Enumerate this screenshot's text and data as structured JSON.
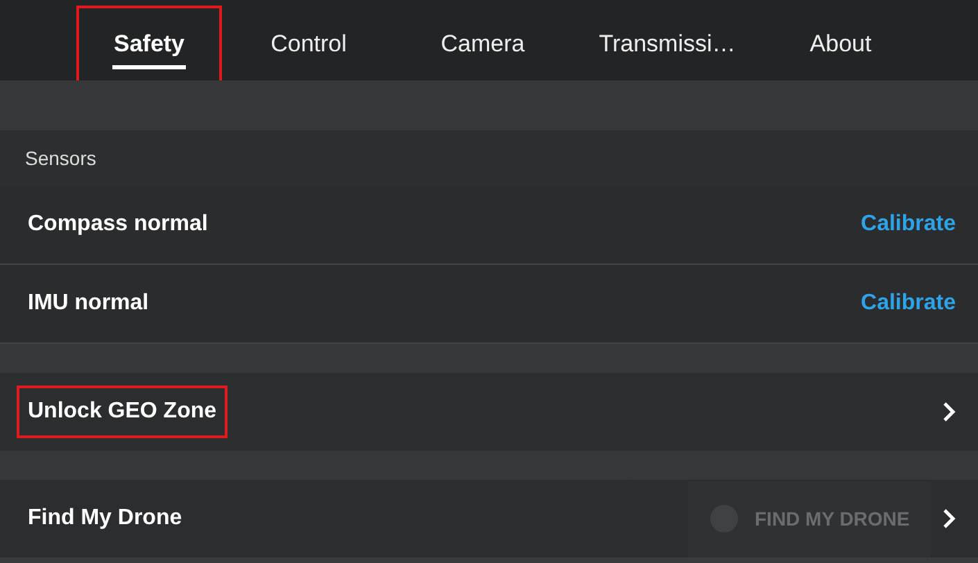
{
  "tabs": [
    {
      "label": "Safety",
      "selected": true,
      "highlighted": true
    },
    {
      "label": "Control",
      "selected": false,
      "highlighted": false
    },
    {
      "label": "Camera",
      "selected": false,
      "highlighted": false
    },
    {
      "label": "Transmissi…",
      "selected": false,
      "highlighted": false
    },
    {
      "label": "About",
      "selected": false,
      "highlighted": false
    }
  ],
  "sensors": {
    "heading": "Sensors",
    "rows": [
      {
        "label": "Compass normal",
        "action": "Calibrate"
      },
      {
        "label": "IMU normal",
        "action": "Calibrate"
      }
    ]
  },
  "links": [
    {
      "label": "Unlock GEO Zone",
      "highlighted": true
    },
    {
      "label": "Find My Drone",
      "highlighted": false
    }
  ],
  "background_map": {
    "button_label": "FIND MY DRONE"
  }
}
